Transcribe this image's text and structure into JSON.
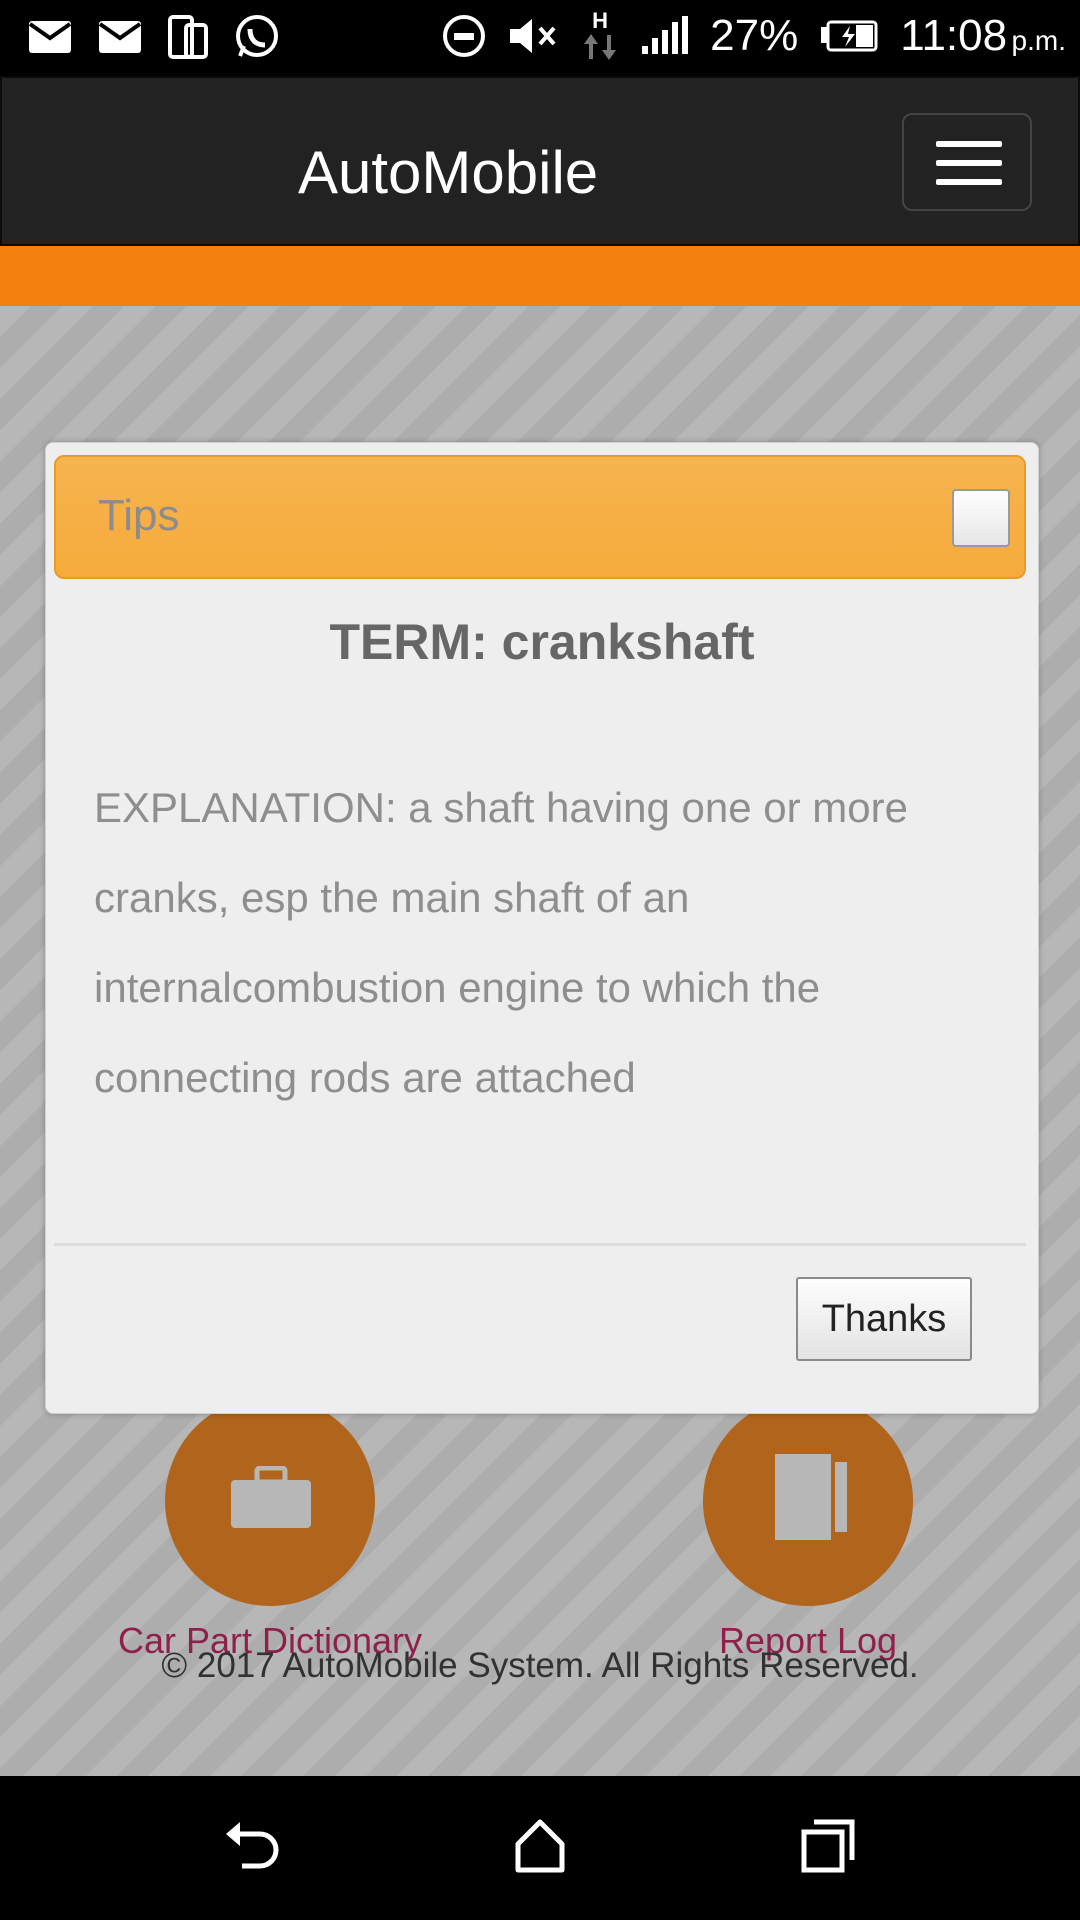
{
  "status_bar": {
    "battery": "27%",
    "time": "11:08",
    "ampm": "p.m.",
    "network": "H",
    "icons": [
      "mail-icon",
      "mail-icon",
      "dual-sim-icon",
      "whatsapp-icon",
      "do-not-disturb-icon",
      "mute-icon",
      "network-data-icon",
      "signal-icon",
      "battery-charging-icon"
    ]
  },
  "header": {
    "title": "AutoMobile",
    "menu_icon": "hamburger-icon"
  },
  "colors": {
    "accent": "#f48012",
    "header_bg": "#222222",
    "dialog_header": "#f6b44f",
    "link": "#c2185b"
  },
  "features": [
    {
      "label": "Car Part Dictionary",
      "icon": "briefcase-icon"
    },
    {
      "label": "Report Log",
      "icon": "document-icon"
    }
  ],
  "footer": {
    "text": "© 2017 AutoMobile System. All Rights Reserved."
  },
  "dialog": {
    "title": "Tips",
    "term": "TERM: crankshaft",
    "explanation": "EXPLANATION: a shaft having one or more cranks, esp the main shaft of an internalcombustion engine to which the connecting rods are attached",
    "button_label": "Thanks"
  },
  "nav_bar": {
    "icons": [
      "back-icon",
      "home-icon",
      "recents-icon"
    ]
  }
}
